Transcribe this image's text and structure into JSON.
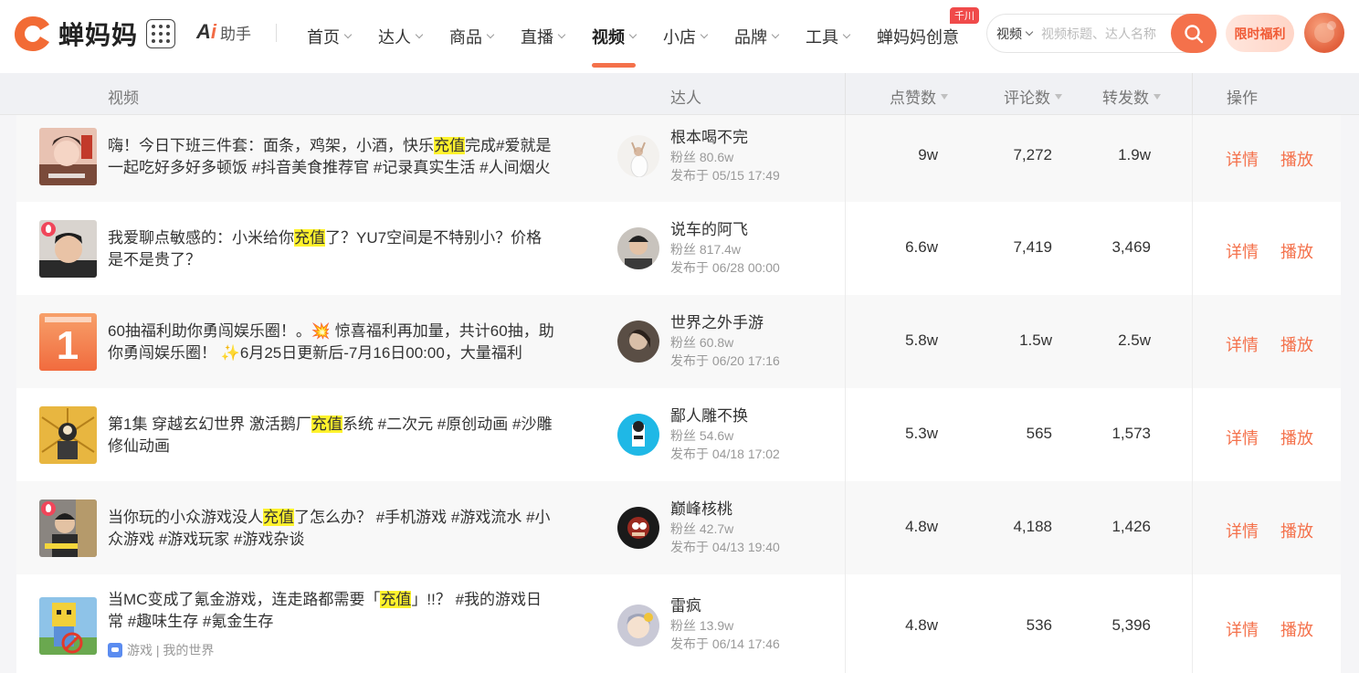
{
  "brand": {
    "name": "蝉妈妈",
    "accent": "#f4714b"
  },
  "ai": {
    "mark_a": "A",
    "mark_i": "i",
    "label": "助手"
  },
  "menu": [
    {
      "label": "首页",
      "chevron": true
    },
    {
      "label": "达人",
      "chevron": true
    },
    {
      "label": "商品",
      "chevron": true
    },
    {
      "label": "直播",
      "chevron": true
    },
    {
      "label": "视频",
      "chevron": true,
      "active": true
    },
    {
      "label": "小店",
      "chevron": true
    },
    {
      "label": "品牌",
      "chevron": true
    },
    {
      "label": "工具",
      "chevron": true
    },
    {
      "label": "蝉妈妈创意",
      "chevron": false,
      "badge": "千川"
    }
  ],
  "search": {
    "type": "视频",
    "placeholder": "视频标题、达人名称",
    "icon": "search-icon"
  },
  "promo": {
    "label": "限时福利"
  },
  "table": {
    "headers": {
      "video": "视频",
      "creator": "达人",
      "likes": "点赞数",
      "comments": "评论数",
      "shares": "转发数",
      "actions": "操作"
    },
    "action_labels": {
      "detail": "详情",
      "play": "播放"
    },
    "rows": [
      {
        "title_parts": [
          "嗨！今日下班三件套：面条，鸡架，小酒，快乐",
          "充值",
          "完成#爱就是一起吃好多好多顿饭 #抖音美食推荐官 #记录真实生活 #人间烟火"
        ],
        "tag": "",
        "live": false,
        "creator": "根本喝不完",
        "fans": "粉丝 80.6w",
        "published": "发布于 05/15 17:49",
        "likes": "9w",
        "comments": "7,272",
        "shares": "1.9w"
      },
      {
        "title_parts": [
          "我爱聊点敏感的：小米给你",
          "充值",
          "了？YU7空间是不特别小？价格是不是贵了？"
        ],
        "tag": "",
        "live": true,
        "creator": "说车的阿飞",
        "fans": "粉丝 817.4w",
        "published": "发布于 06/28 00:00",
        "likes": "6.6w",
        "comments": "7,419",
        "shares": "3,469"
      },
      {
        "title_parts": [
          "60抽福利助你勇闯娱乐圈！。💥 惊喜福利再加量，共计60抽，助你勇闯娱乐圈！ ✨6月25日更新后-7月16日00:00，大量福利"
        ],
        "tag": "",
        "live": false,
        "creator": "世界之外手游",
        "fans": "粉丝 60.8w",
        "published": "发布于 06/20 17:16",
        "likes": "5.8w",
        "comments": "1.5w",
        "shares": "2.5w"
      },
      {
        "title_parts": [
          "第1集 穿越玄幻世界 激活鹅厂",
          "充值",
          "系统 #二次元 #原创动画 #沙雕修仙动画"
        ],
        "tag": "",
        "live": false,
        "creator": "鄙人雕不换",
        "fans": "粉丝 54.6w",
        "published": "发布于 04/18 17:02",
        "likes": "5.3w",
        "comments": "565",
        "shares": "1,573"
      },
      {
        "title_parts": [
          "当你玩的小众游戏没人",
          "充值",
          "了怎么办？ #手机游戏 #游戏流水 #小众游戏 #游戏玩家 #游戏杂谈"
        ],
        "tag": "",
        "live": true,
        "creator": "巅峰核桃",
        "fans": "粉丝 42.7w",
        "published": "发布于 04/13 19:40",
        "likes": "4.8w",
        "comments": "4,188",
        "shares": "1,426"
      },
      {
        "title_parts": [
          "当MC变成了氪金游戏，连走路都需要「",
          "充值",
          "」!!？ #我的游戏日常 #趣味生存 #氪金生存"
        ],
        "tag": "游戏 | 我的世界",
        "live": false,
        "creator": "雷疯",
        "fans": "粉丝 13.9w",
        "published": "发布于 06/14 17:46",
        "likes": "4.8w",
        "comments": "536",
        "shares": "5,396"
      }
    ]
  }
}
